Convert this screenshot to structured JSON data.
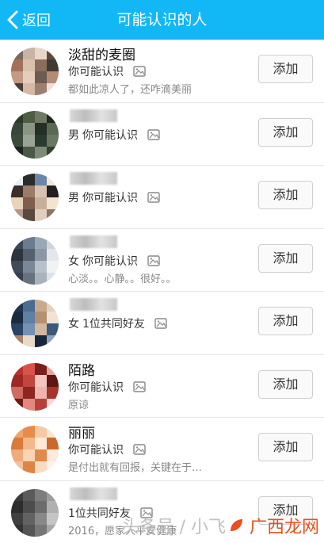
{
  "header": {
    "back_label": "返回",
    "title": "可能认识的人"
  },
  "add_label": "添加",
  "rows": [
    {
      "name": "淡甜的麦圈",
      "gender": "",
      "relation": "你可能认识",
      "signature": "都如此凉人了，还咋滴美丽"
    },
    {
      "name": "",
      "gender": "男",
      "relation": "你可能认识",
      "signature": ""
    },
    {
      "name": "",
      "gender": "男",
      "relation": "你可能认识",
      "signature": ""
    },
    {
      "name": "",
      "gender": "女",
      "relation": "你可能认识",
      "signature": "心淡。。心静。。很好。。"
    },
    {
      "name": "",
      "gender": "女",
      "relation": "1位共同好友",
      "signature": ""
    },
    {
      "name": "陌路",
      "gender": "",
      "relation": "你可能认识",
      "signature": "原谅"
    },
    {
      "name": "丽丽",
      "gender": "",
      "relation": "你可能认识",
      "signature": "是付出就有回报，关键在于…"
    },
    {
      "name": "",
      "gender": "",
      "relation": "1位共同好友",
      "signature": "2016，愿家人平安健康"
    }
  ],
  "watermark": {
    "text": "头条号 / 小飞",
    "brand": "广西龙网"
  }
}
